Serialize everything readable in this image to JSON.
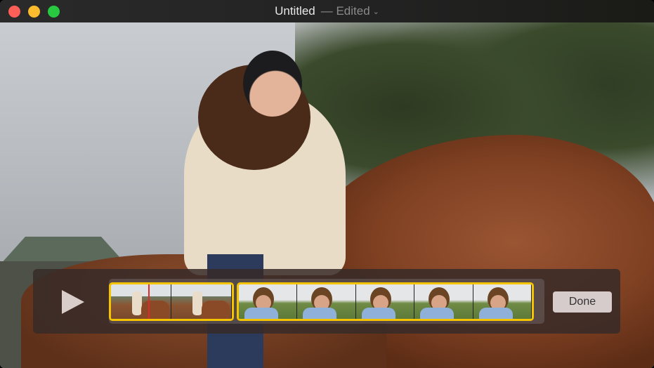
{
  "window": {
    "title": "Untitled",
    "status": "— Edited",
    "chevron": "⌄"
  },
  "controls": {
    "play_icon": "play-icon",
    "done_label": "Done"
  },
  "colors": {
    "selection": "#f5c400",
    "playhead": "#e02a2a"
  },
  "clips": [
    {
      "frames": 2,
      "type": "horse-riding"
    },
    {
      "frames": 5,
      "type": "boy-portrait"
    }
  ]
}
